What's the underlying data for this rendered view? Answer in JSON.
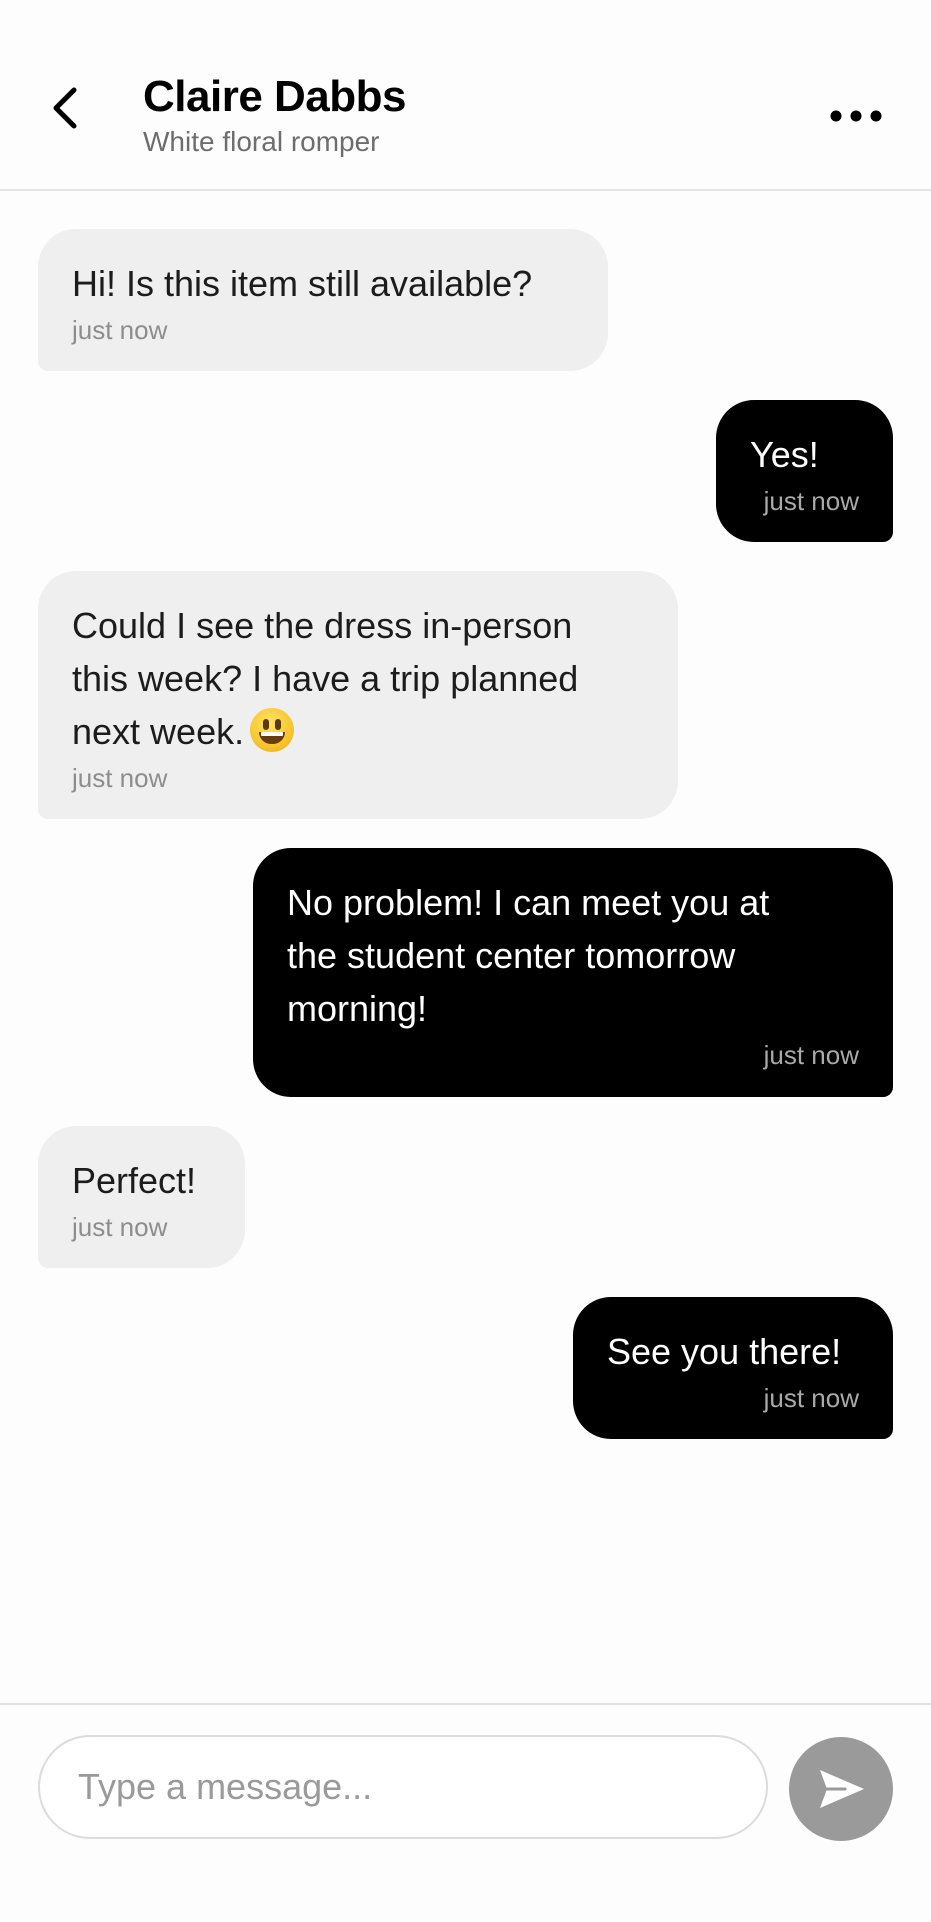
{
  "header": {
    "back_icon": "chevron-left-icon",
    "title": "Claire Dabbs",
    "subtitle": "White floral romper",
    "more_icon": "more-horizontal-icon"
  },
  "messages": [
    {
      "direction": "incoming",
      "text": "Hi! Is this item still available?",
      "time": "just now"
    },
    {
      "direction": "outgoing",
      "text": "Yes!",
      "time": "just now"
    },
    {
      "direction": "incoming",
      "text": "Could I see the dress in-person\nthis week? I have a trip planned\nnext week.",
      "emoji": "grinning-face-icon",
      "time": "just now"
    },
    {
      "direction": "outgoing",
      "text": "No problem! I can meet you at\nthe student center tomorrow\nmorning!",
      "time": "just now"
    },
    {
      "direction": "incoming",
      "text": "Perfect!",
      "time": "just now"
    },
    {
      "direction": "outgoing",
      "text": "See you there!",
      "time": "just now"
    }
  ],
  "composer": {
    "placeholder": "Type a message...",
    "value": "",
    "send_icon": "send-icon"
  },
  "colors": {
    "incoming_bubble": "#efefef",
    "outgoing_bubble": "#000000",
    "send_button": "#9a9a9a",
    "timestamp": "#8d8d8d"
  }
}
